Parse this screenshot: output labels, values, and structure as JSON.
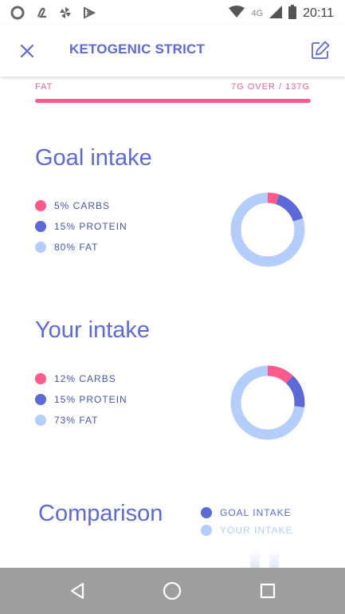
{
  "status": {
    "time": "20:11",
    "network": "4G",
    "icons": [
      "opera-icon",
      "link-icon",
      "pinwheel-icon",
      "play-icon",
      "wifi-icon",
      "signal-icon",
      "battery-icon"
    ]
  },
  "appbar": {
    "title": "KETOGENIC STRICT",
    "close_icon": "close-icon",
    "edit_icon": "edit-icon"
  },
  "fat_limit": {
    "label": "FAT",
    "status": "7G OVER / 137G",
    "fill_fraction": 1.0,
    "color": "#ff5b8a"
  },
  "goal_intake": {
    "title": "Goal intake",
    "items": [
      {
        "label": "5% CARBS",
        "percent": 5,
        "color": "#ff5b8a"
      },
      {
        "label": "15% PROTEIN",
        "percent": 15,
        "color": "#5b6ad8"
      },
      {
        "label": "80% FAT",
        "percent": 80,
        "color": "#b3cdfc"
      }
    ]
  },
  "your_intake": {
    "title": "Your intake",
    "items": [
      {
        "label": "12% CARBS",
        "percent": 12,
        "color": "#ff5b8a"
      },
      {
        "label": "15% PROTEIN",
        "percent": 15,
        "color": "#5b6ad8"
      },
      {
        "label": "73% FAT",
        "percent": 73,
        "color": "#b3cdfc"
      }
    ]
  },
  "comparison": {
    "title": "Comparison",
    "legend": [
      {
        "label": "GOAL INTAKE",
        "color": "#5b6ad8"
      },
      {
        "label": "YOUR INTAKE",
        "color": "#b3cdfc"
      }
    ]
  },
  "navbar": {
    "back_icon": "back-icon",
    "home_icon": "home-icon",
    "recents_icon": "recents-icon"
  }
}
